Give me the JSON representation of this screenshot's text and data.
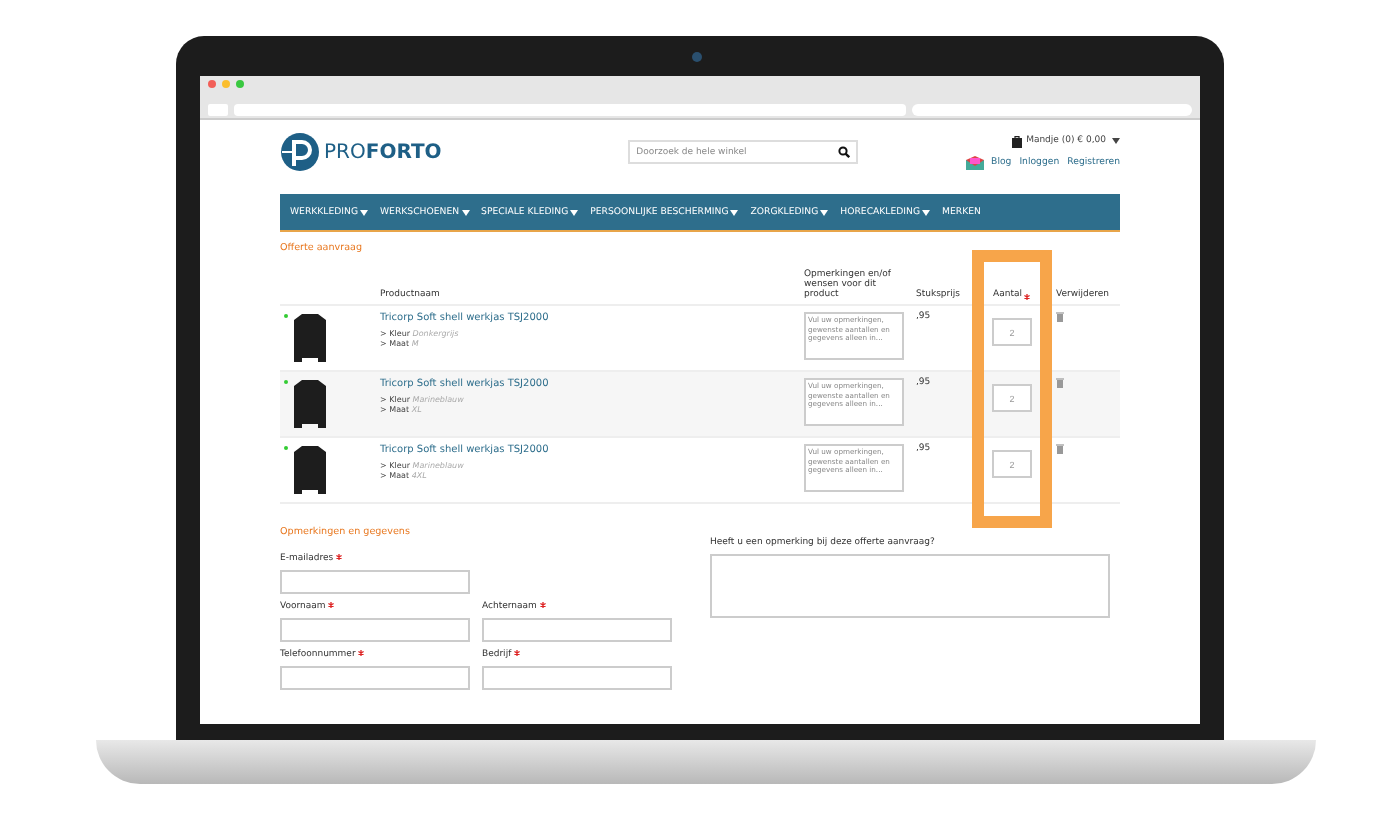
{
  "header": {
    "logo_text": "PRO**FORTO**",
    "search": {
      "placeholder": "Doorzoek de hele winkel"
    },
    "cart": "Mandje (0) € 0,00",
    "links": [
      "Blog",
      "Inloggen",
      "Registreren"
    ]
  },
  "nav": [
    {
      "label": "WERKKLEDING",
      "dropdown": true
    },
    {
      "label": "WERKSCHOENEN",
      "dropdown": true
    },
    {
      "label": "SPECIALE KLEDING",
      "dropdown": true
    },
    {
      "label": "PERSOONLIJKE BESCHERMING",
      "dropdown": true
    },
    {
      "label": "ZORGKLEDING",
      "dropdown": true
    },
    {
      "label": "HORECAKLEDING",
      "dropdown": true
    },
    {
      "label": "MERKEN",
      "dropdown": false
    }
  ],
  "page_title": "Offerte aanvraag",
  "table": {
    "columns": [
      {
        "label": "Productnaam",
        "required": false
      },
      {
        "label": "Opmerkingen en/of wensen voor dit product",
        "required": false
      },
      {
        "label": "Stuksprijs",
        "required": false
      },
      {
        "label": "Aantal",
        "required": true
      },
      {
        "label": "Verwijderen",
        "required": false
      }
    ],
    "rows": [
      {
        "name": "Tricorp Soft shell werkjas TSJ2000",
        "attributes": [
          {
            "label": "> Kleur",
            "value": "Donkergrijs"
          },
          {
            "label": "> Maat",
            "value": "M"
          }
        ],
        "remarks_placeholder": "Vul uw opmerkingen, gewenste aantallen en gegevens alleen in...",
        "price": ",95",
        "quantity": "2"
      },
      {
        "name": "Tricorp Soft shell werkjas TSJ2000",
        "attributes": [
          {
            "label": "> Kleur",
            "value": "Marineblauw"
          },
          {
            "label": "> Maat",
            "value": "XL"
          }
        ],
        "remarks_placeholder": "Vul uw opmerkingen, gewenste aantallen en gegevens alleen in...",
        "price": ",95",
        "quantity": "2"
      },
      {
        "name": "Tricorp Soft shell werkjas TSJ2000",
        "attributes": [
          {
            "label": "> Kleur",
            "value": "Marineblauw"
          },
          {
            "label": "> Maat",
            "value": "4XL"
          }
        ],
        "remarks_placeholder": "Vul uw opmerkingen, gewenste aantallen en gegevens alleen in...",
        "price": ",95",
        "quantity": "2"
      }
    ]
  },
  "form": {
    "title": "Opmerkingen en gegevens",
    "rows": [
      [
        {
          "label": "E-mailadres",
          "required": true
        }
      ],
      [
        {
          "label": "Voornaam",
          "required": true
        },
        {
          "label": "Achternaam",
          "required": true
        }
      ],
      [
        {
          "label": "Telefoonnummer",
          "required": true
        },
        {
          "label": "Bedrijf",
          "required": true
        }
      ]
    ],
    "remark_label": "Heeft u een opmerking bij deze offerte aanvraag?"
  }
}
